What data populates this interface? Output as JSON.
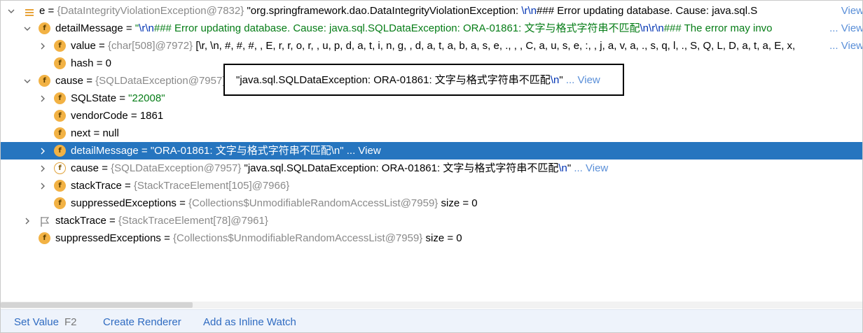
{
  "rows": [
    {
      "name": "e",
      "type": "{DataIntegrityViolationException@7832}",
      "value": "\"org.springframework.dao.DataIntegrityViolationException: ",
      "esc": "\\r\\n",
      "value2": "### Error updating database.  Cause: java.sql.S",
      "view": "View"
    },
    {
      "name": "detailMessage",
      "eq": " = ",
      "value": "\"",
      "esc": "\\r\\n",
      "value2": "### Error updating database.  Cause: java.sql.SQLDataException: ORA-01861: 文字与格式字符串不匹配",
      "esc2": "\\n\\r\\n",
      "value3": "### The error may invo",
      "view": "... View"
    },
    {
      "name": "value",
      "type": "{char[508]@7972}",
      "value": "[\\r, \\n, #, #, #,  , E, r, r, o, r,  , u, p, d, a, t, i, n, g,  , d, a, t, a, b, a, s, e, .,  ,  , C, a, u, s, e, :,  , j, a, v, a, ., s, q, l, ., S, Q, L, D, a, t, a, E, x,",
      "view": "... View"
    },
    {
      "name": "hash",
      "eq": " = ",
      "value": "0"
    },
    {
      "name": "cause",
      "type": "{SQLDataException@7957}"
    },
    {
      "name": "SQLState",
      "eq": " = ",
      "value": "\"22008\""
    },
    {
      "name": "vendorCode",
      "eq": " = ",
      "value": "1861"
    },
    {
      "name": "next",
      "eq": " = ",
      "value": "null"
    },
    {
      "name": "detailMessage",
      "eq": " = ",
      "value": "\"ORA-01861: 文字与格式字符串不匹配",
      "esc": "\\n",
      "value2": "\"",
      "view": "... View"
    },
    {
      "name": "cause",
      "type": "{SQLDataException@7957}",
      "value": "\"java.sql.SQLDataException: ORA-01861: 文字与格式字符串不匹配",
      "esc": "\\n",
      "value2": "\"",
      "view": "... View"
    },
    {
      "name": "stackTrace",
      "type": "{StackTraceElement[105]@7966}"
    },
    {
      "name": "suppressedExceptions",
      "type": "{Collections$UnmodifiableRandomAccessList@7959}",
      "size": "size = 0"
    },
    {
      "name": "stackTrace",
      "type": "{StackTraceElement[78]@7961}"
    },
    {
      "name": "suppressedExceptions",
      "type": "{Collections$UnmodifiableRandomAccessList@7959}",
      "size": "size = 0"
    }
  ],
  "tooltip": {
    "value": "\"java.sql.SQLDataException: ORA-01861: 文字与格式字符串不匹配",
    "esc": "\\n",
    "value2": "\"",
    "view": "... View"
  },
  "badge_letter": "f",
  "eq": " = ",
  "footer": {
    "set_value": "Set Value",
    "set_value_key": "F2",
    "create_renderer": "Create Renderer",
    "add_inline_watch": "Add as Inline Watch"
  }
}
